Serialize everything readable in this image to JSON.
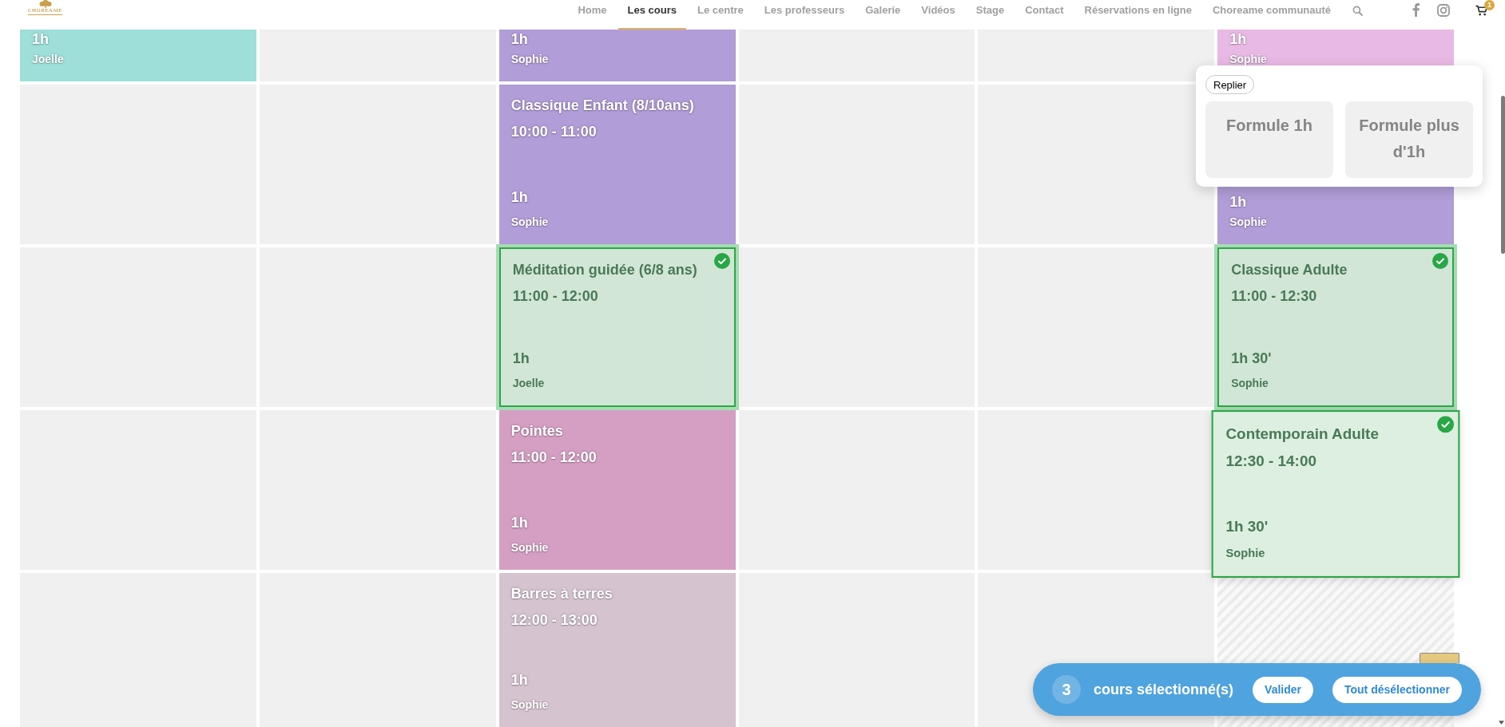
{
  "header": {
    "logo_text": "CHOREAME",
    "nav": [
      {
        "label": "Home",
        "selected": false
      },
      {
        "label": "Les cours",
        "selected": true
      },
      {
        "label": "Le centre",
        "selected": false
      },
      {
        "label": "Les professeurs",
        "selected": false
      },
      {
        "label": "Galerie",
        "selected": false
      },
      {
        "label": "Vidéos",
        "selected": false
      },
      {
        "label": "Stage",
        "selected": false
      },
      {
        "label": "Contact",
        "selected": false
      },
      {
        "label": "Réservations en ligne",
        "selected": false
      },
      {
        "label": "Choreame communauté",
        "selected": false
      }
    ],
    "cart_count": "1"
  },
  "schedule": {
    "rows": [
      {
        "cells": [
          {
            "kind": "course",
            "duration": "1h",
            "teacher": "Joelle",
            "color": "#9ee0d9",
            "selected": false,
            "hovered": false
          },
          {
            "kind": "empty"
          },
          {
            "kind": "course",
            "duration": "1h",
            "teacher": "Sophie",
            "color": "#b19dd8",
            "selected": false,
            "hovered": false
          },
          {
            "kind": "empty"
          },
          {
            "kind": "empty"
          },
          {
            "kind": "course",
            "duration": "1h",
            "teacher": "Sophie",
            "color": "#e8b9e4",
            "selected": false,
            "hovered": false
          }
        ]
      },
      {
        "cells": [
          {
            "kind": "empty"
          },
          {
            "kind": "empty"
          },
          {
            "kind": "course",
            "title": "Classique Enfant (8/10ans)",
            "time": "10:00 - 11:00",
            "duration": "1h",
            "teacher": "Sophie",
            "color": "#b19dd8",
            "selected": false,
            "hovered": false
          },
          {
            "kind": "empty"
          },
          {
            "kind": "empty"
          },
          {
            "kind": "course",
            "duration": "1h",
            "teacher": "Sophie",
            "color": "#b19dd8",
            "selected": false,
            "hovered": false
          }
        ]
      },
      {
        "cells": [
          {
            "kind": "empty"
          },
          {
            "kind": "empty"
          },
          {
            "kind": "course",
            "title": "Méditation guidée (6/8 ans)",
            "time": "11:00 - 12:00",
            "duration": "1h",
            "teacher": "Joelle",
            "selected": true,
            "hovered": false
          },
          {
            "kind": "empty"
          },
          {
            "kind": "empty"
          },
          {
            "kind": "course",
            "title": "Classique Adulte",
            "time": "11:00 - 12:30",
            "duration": "1h 30'",
            "teacher": "Sophie",
            "selected": true,
            "hovered": false
          }
        ]
      },
      {
        "cells": [
          {
            "kind": "empty"
          },
          {
            "kind": "empty"
          },
          {
            "kind": "course",
            "title": "Pointes",
            "time": "11:00 - 12:00",
            "duration": "1h",
            "teacher": "Sophie",
            "color": "#d49fc2",
            "selected": false,
            "hovered": false
          },
          {
            "kind": "empty"
          },
          {
            "kind": "empty"
          },
          {
            "kind": "course",
            "title": "Contemporain Adulte",
            "time": "12:30 - 14:00",
            "duration": "1h 30'",
            "teacher": "Sophie",
            "selected": true,
            "hovered": true
          }
        ]
      },
      {
        "cells": [
          {
            "kind": "empty"
          },
          {
            "kind": "empty"
          },
          {
            "kind": "course",
            "title": "Barres à terres",
            "time": "12:00 - 13:00",
            "duration": "1h",
            "teacher": "Sophie",
            "color": "#d5c3d0",
            "selected": false,
            "hovered": false
          },
          {
            "kind": "empty"
          },
          {
            "kind": "empty"
          },
          {
            "kind": "unavailable"
          }
        ]
      }
    ]
  },
  "formula_popup": {
    "collapse_button": "Replier",
    "options": [
      {
        "label": "Formule 1h"
      },
      {
        "label": "Formule plus d'1h"
      }
    ]
  },
  "selection_bar": {
    "count": "3",
    "label": "cours sélectionné(s)",
    "buttons": [
      "Valider",
      "Tout désélectionner"
    ]
  }
}
